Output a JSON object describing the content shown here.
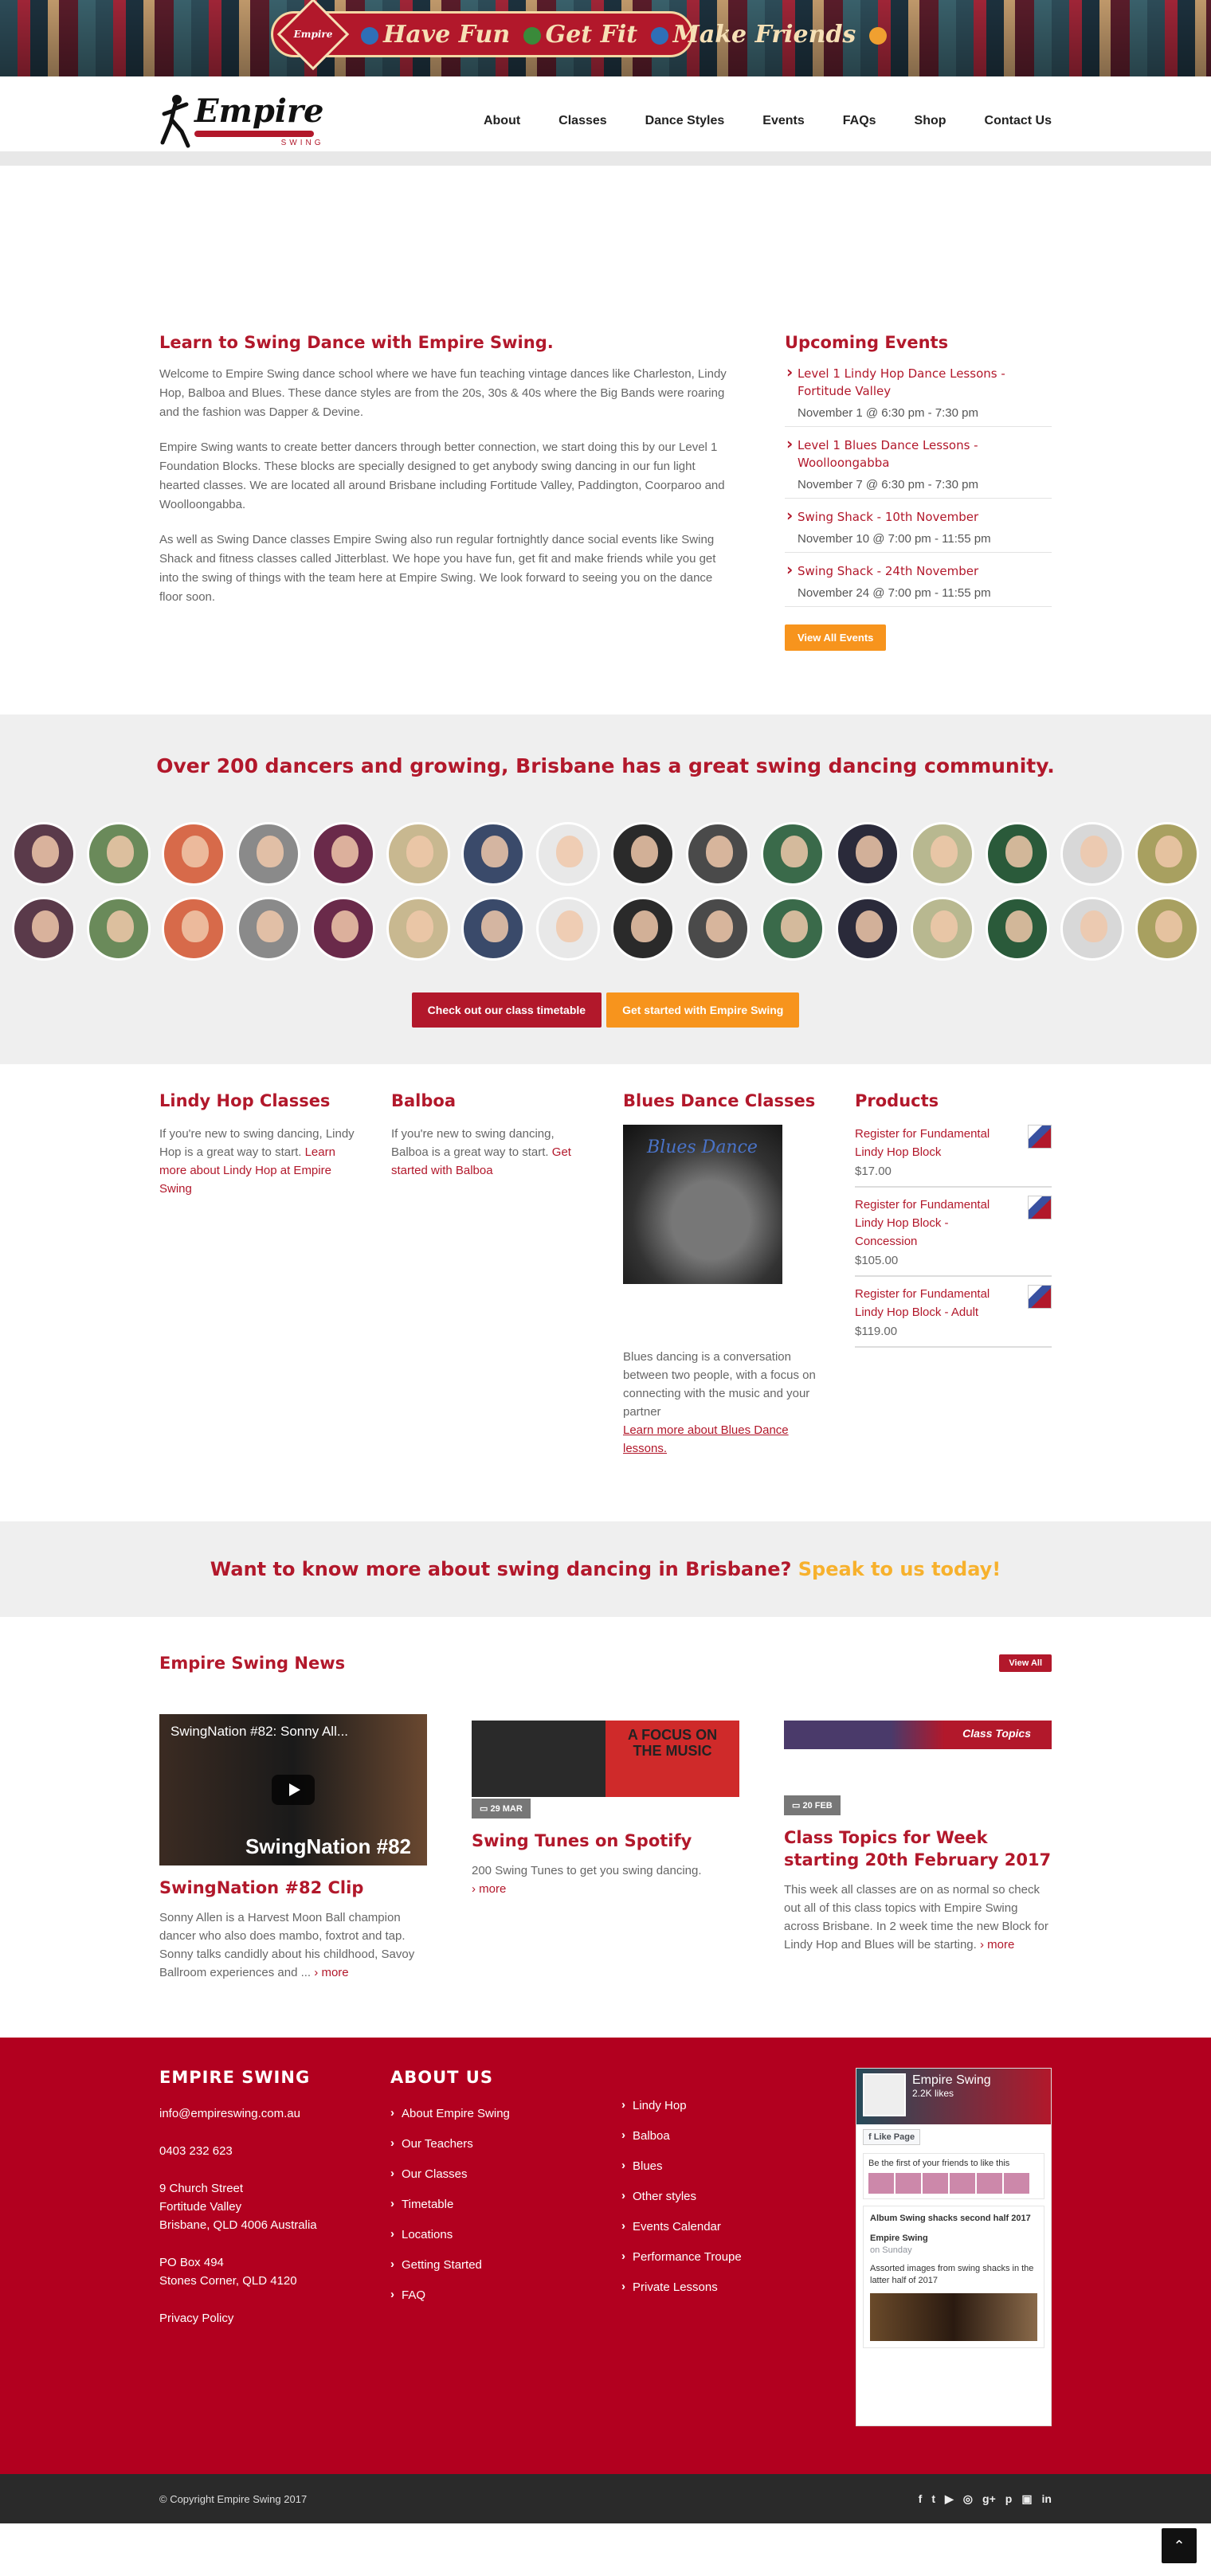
{
  "banner": {
    "badge": "Empire",
    "slogan_1": "Have Fun",
    "slogan_2": "Get Fit",
    "slogan_3": "Make Friends"
  },
  "header": {
    "logo_word": "Empire",
    "logo_sub": "SWING",
    "nav": [
      "About",
      "Classes",
      "Dance Styles",
      "Events",
      "FAQs",
      "Shop",
      "Contact Us"
    ]
  },
  "intro": {
    "title": "Learn to Swing Dance with Empire Swing.",
    "paragraphs": [
      "Welcome to Empire Swing dance school where we have fun teaching vintage dances like Charleston, Lindy Hop, Balboa and Blues. These dance styles are from the 20s, 30s & 40s where the Big Bands were roaring and the fashion was Dapper & Devine.",
      "Empire Swing wants to create better dancers through better connection, we start doing this by our Level 1 Foundation Blocks. These blocks are specially designed to get anybody swing dancing in our fun light hearted classes. We are located all around Brisbane including Fortitude Valley, Paddington, Coorparoo and Woolloongabba.",
      "As well as Swing Dance classes Empire Swing also run regular fortnightly dance social events like Swing Shack and fitness classes called Jitterblast. We hope you have fun, get fit and make friends while you get into the swing of things with the team here at Empire Swing. We look forward to seeing you on the dance floor soon."
    ]
  },
  "events": {
    "title": "Upcoming Events",
    "items": [
      {
        "title": "Level 1 Lindy Hop Dance Lessons - Fortitude Valley",
        "date": "November 1 @ 6:30 pm - 7:30 pm"
      },
      {
        "title": "Level 1 Blues Dance Lessons - Woolloongabba",
        "date": "November 7 @ 6:30 pm - 7:30 pm"
      },
      {
        "title": "Swing Shack - 10th November",
        "date": "November 10 @ 7:00 pm - 11:55 pm"
      },
      {
        "title": "Swing Shack - 24th November",
        "date": "November 24 @ 7:00 pm - 11:55 pm"
      }
    ],
    "button": "View All Events"
  },
  "community": {
    "title": "Over 200 dancers and growing, Brisbane has a great swing dancing community.",
    "btn_timetable": "Check out our class timetable",
    "btn_started": "Get started with Empire Swing",
    "face_colors": [
      "#5a3a4a",
      "#6a8a5a",
      "#d76a4a",
      "#8a8a8a",
      "#6a2a4a",
      "#c8b890",
      "#3a4a6a",
      "#e8e8e8",
      "#2a2a2a",
      "#4a4a4a",
      "#3a6a4a",
      "#2a2a3a",
      "#b8b890",
      "#2a5a3a",
      "#d8d8d8",
      "#a8a060"
    ]
  },
  "classes": {
    "lindy": {
      "title": "Lindy Hop Classes",
      "text": "If you're new to swing dancing, Lindy Hop is a great way to start.",
      "link": "Learn more about Lindy Hop at Empire Swing"
    },
    "balboa": {
      "title": "Balboa",
      "text": "If you're new to swing dancing, Balboa is a great way to start.",
      "link": "Get started with Balboa"
    },
    "blues": {
      "title": "Blues Dance Classes",
      "image_text": "Blues Dance",
      "text": "Blues dancing is a conversation between two people, with a focus on connecting with the music and your partner",
      "link": "Learn more about Blues Dance lessons."
    },
    "products": {
      "title": "Products",
      "items": [
        {
          "name": "Register for Fundamental Lindy Hop Block",
          "price": "$17.00"
        },
        {
          "name": "Register for Fundamental Lindy Hop Block - Concession",
          "price": "$105.00"
        },
        {
          "name": "Register for Fundamental Lindy Hop Block - Adult",
          "price": "$119.00"
        }
      ]
    }
  },
  "speak": {
    "text": "Want to know more about swing dancing in Brisbane?",
    "link": "Speak to us today!"
  },
  "news": {
    "title": "Empire Swing News",
    "view_all": "View All",
    "cards": [
      {
        "video_title": "SwingNation #82: Sonny All...",
        "video_badge": "SwingNation #82",
        "title": "SwingNation #82 Clip",
        "text": "Sonny Allen is a Harvest Moon Ball champion dancer who also does mambo, foxtrot and tap. Sonny talks candidly about his childhood, Savoy Ballroom experiences and ...",
        "more": "more"
      },
      {
        "image_text": "A FOCUS ON THE MUSIC",
        "date": "29 MAR",
        "title": "Swing Tunes on Spotify",
        "text": "200 Swing Tunes to get you swing dancing.",
        "more": "more"
      },
      {
        "image_text": "Class Topics",
        "date": "20 FEB",
        "title": "Class Topics for Week starting 20th February 2017",
        "text": "This week all classes are on as normal so check out all of this class topics with Empire Swing across Brisbane. In 2 week time the new Block for Lindy Hop and Blues will be starting.",
        "more": "more"
      }
    ]
  },
  "footer": {
    "brand": "EMPIRE SWING",
    "email": "info@empireswing.com.au",
    "phone": "0403 232 623",
    "address_1": "9 Church Street",
    "address_2": "Fortitude Valley",
    "address_3": "Brisbane, QLD 4006 Australia",
    "po_1": "PO Box 494",
    "po_2": "Stones Corner, QLD 4120",
    "privacy": "Privacy Policy",
    "about_title": "ABOUT US",
    "about_links": [
      "About Empire Swing",
      "Our Teachers",
      "Our Classes",
      "Timetable",
      "Locations",
      "Getting Started",
      "FAQ"
    ],
    "style_links": [
      "Lindy Hop",
      "Balboa",
      "Blues",
      "Other styles",
      "Events Calendar",
      "Performance Troupe",
      "Private Lessons"
    ],
    "facebook": {
      "name": "Empire Swing",
      "likes": "2.2K likes",
      "like_btn": "Like Page",
      "friends_text": "Be the first of your friends to like this",
      "album": "Album Swing shacks second half 2017",
      "post_name": "Empire Swing",
      "post_time": "on Sunday",
      "post_text": "Assorted images from swing shacks in the latter half of 2017"
    }
  },
  "bottom": {
    "copyright": "© Copyright Empire Swing 2017",
    "social_icons": [
      "facebook-icon",
      "twitter-icon",
      "youtube-icon",
      "instagram-icon",
      "google-plus-icon",
      "pinterest-icon",
      "youtube-tube-icon",
      "linkedin-icon"
    ],
    "social_glyphs": [
      "f",
      "t",
      "▶",
      "◎",
      "g+",
      "p",
      "▣",
      "in"
    ],
    "to_top": "⌃"
  }
}
